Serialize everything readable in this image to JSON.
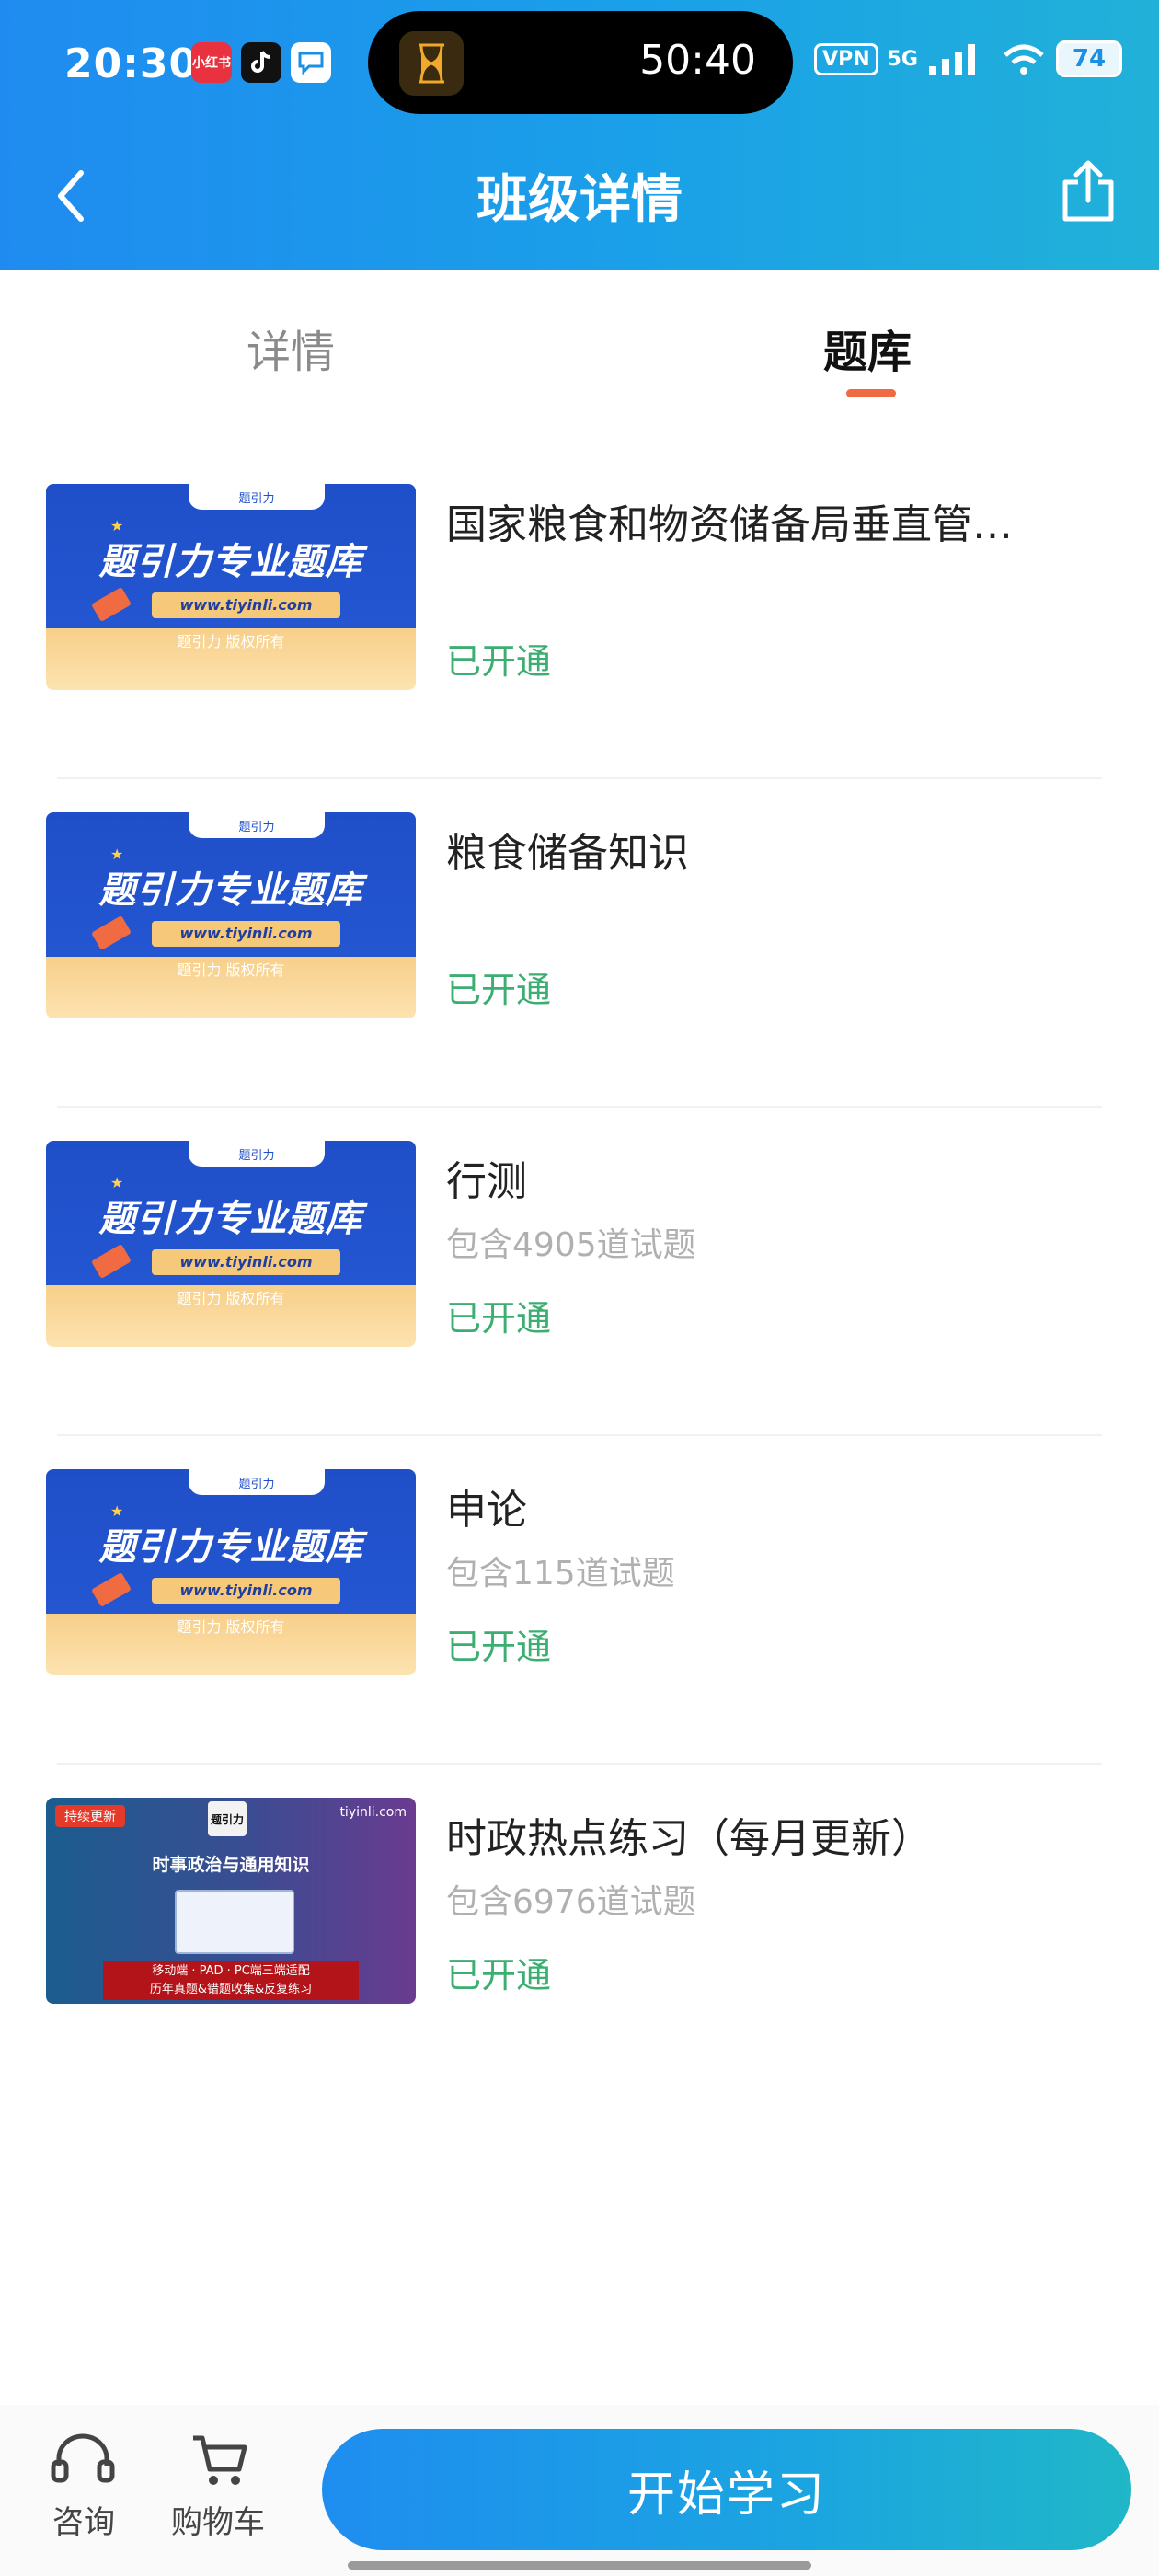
{
  "status_bar": {
    "time": "20:30",
    "app_icons": [
      "小红书",
      "tiktok-icon",
      "chat-icon"
    ],
    "timer": "50:40",
    "vpn": "VPN",
    "network": "5G",
    "battery": "74"
  },
  "nav": {
    "title": "班级详情"
  },
  "tabs": [
    {
      "label": "详情",
      "active": false
    },
    {
      "label": "题库",
      "active": true
    }
  ],
  "thumbnail": {
    "brand_small": "题引力",
    "title": "题引力专业题库",
    "url": "www.tiyinli.com",
    "copyright": "题引力 版权所有"
  },
  "politics_thumbnail": {
    "badge": "持续更新",
    "site": "tiyinli.com",
    "title": "时事政治与通用知识",
    "bar_line1": "移动端 · PAD · PC端三端适配",
    "bar_line2": "历年真题&错题收集&反复练习"
  },
  "items": [
    {
      "title": "国家粮食和物资储备局垂直管…",
      "sub": "",
      "status": "已开通"
    },
    {
      "title": "粮食储备知识",
      "sub": "",
      "status": "已开通"
    },
    {
      "title": "行测",
      "sub": "包含4905道试题",
      "status": "已开通"
    },
    {
      "title": "申论",
      "sub": "包含115道试题",
      "status": "已开通"
    },
    {
      "title": "时政热点练习（每月更新）",
      "sub": "包含6976道试题",
      "status": "已开通"
    }
  ],
  "bottom": {
    "consult": "咨询",
    "cart": "购物车",
    "start": "开始学习"
  },
  "colors": {
    "header_start": "#1f8bf0",
    "header_end": "#21b1d8",
    "status_green": "#3cae72",
    "tab_indicator": "#f06a42"
  }
}
